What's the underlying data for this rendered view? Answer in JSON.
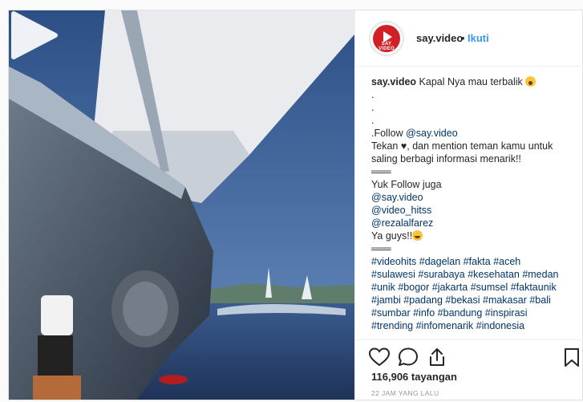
{
  "post": {
    "username": "say.video",
    "separator": "•",
    "follow_label": "Ikuti",
    "avatar_text": "SAY VIDEO"
  },
  "caption": {
    "title": "Kapal Nya mau terbalik",
    "dot1": ".",
    "dot2": ".",
    "dot3": ".",
    "follow_prefix": ".Follow ",
    "follow_handle": "@say.video",
    "tekan_start": "Tekan ",
    "tekan_rest": ", dan mention teman kamu untuk",
    "line2": "saling berbagi informasi menarik!!",
    "dashes": "═══",
    "yuk": "Yuk Follow juga",
    "handle1": "@say.video",
    "handle2": "@video_hitss",
    "handle3": "@rezalalfarez",
    "ya_guys": "Ya guys!!",
    "dashes2": "═══",
    "tags1": "#videohits #dagelan #fakta #aceh",
    "tags2": "#sulawesi #surabaya #kesehatan #medan",
    "tags3": "#unik #bogor #jakarta #sumsel #faktaunik",
    "tags4": "#jambi #padang #bekasi #makasar #bali",
    "tags5": "#sumbar #info #bandung #inspirasi",
    "tags6": "#trending #infomenarik #indonesia"
  },
  "stats": {
    "views": "116,906 tayangan",
    "time": "22 JAM YANG LALU"
  },
  "icons": {
    "like": "heart-outline-icon",
    "comment": "comment-icon",
    "share": "share-icon",
    "save": "bookmark-icon",
    "play": "play-icon"
  },
  "colors": {
    "link": "#003569",
    "follow": "#3897f0",
    "brand": "#d21f26"
  }
}
